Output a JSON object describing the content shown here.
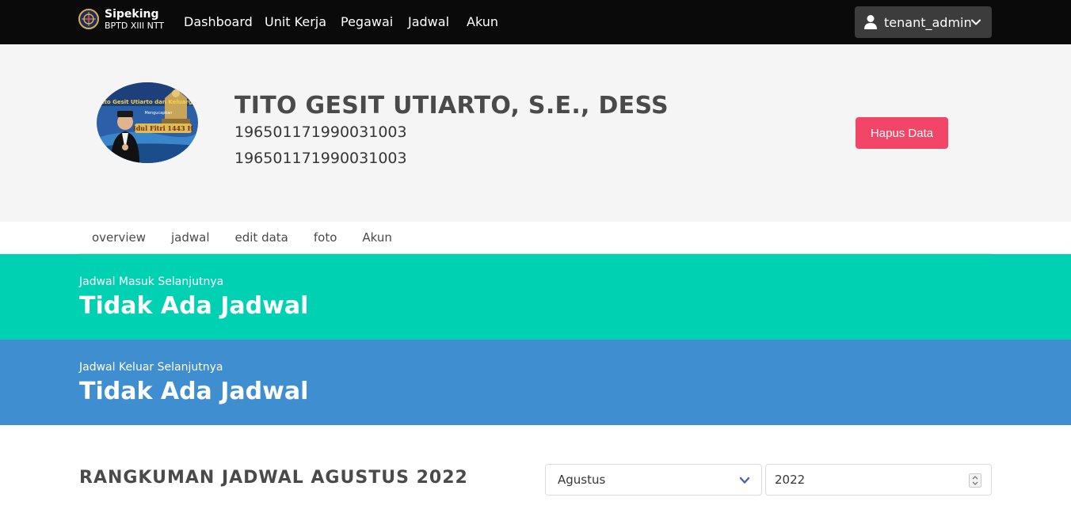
{
  "navbar": {
    "brand_name": "Sipeking",
    "brand_sub": "BPTD XIII NTT",
    "items": [
      {
        "label": "Dashboard"
      },
      {
        "label": "Unit Kerja"
      },
      {
        "label": "Pegawai"
      },
      {
        "label": "Jadwal"
      },
      {
        "label": "Akun"
      }
    ],
    "user": {
      "name": "tenant_admin",
      "icon": "user-icon"
    }
  },
  "profile": {
    "name": "TITO GESIT UTIARTO, S.E., DESS",
    "nip_primary": "196501171990031003",
    "nip_secondary": "196501171990031003",
    "photo": {
      "top_text": "Tito Gesit Utiarto dan Keluarga",
      "mid_text": "Mengucapkan",
      "main_text": "Idul Fitri 1443 H"
    },
    "delete_button": "Hapus Data"
  },
  "tabs": [
    {
      "label": "overview"
    },
    {
      "label": "jadwal"
    },
    {
      "label": "edit data"
    },
    {
      "label": "foto"
    },
    {
      "label": "Akun"
    }
  ],
  "next_in": {
    "label": "Jadwal Masuk Selanjutnya",
    "value": "Tidak Ada Jadwal"
  },
  "next_out": {
    "label": "Jadwal Keluar Selanjutnya",
    "value": "Tidak Ada Jadwal"
  },
  "summary": {
    "title": "RANGKUMAN JADWAL AGUSTUS 2022",
    "month_value": "Agustus",
    "year_value": "2022"
  },
  "colors": {
    "navbar": "#0a0a0a",
    "danger": "#f14668",
    "primary": "#00d1b2",
    "info": "#3e8ed0"
  }
}
